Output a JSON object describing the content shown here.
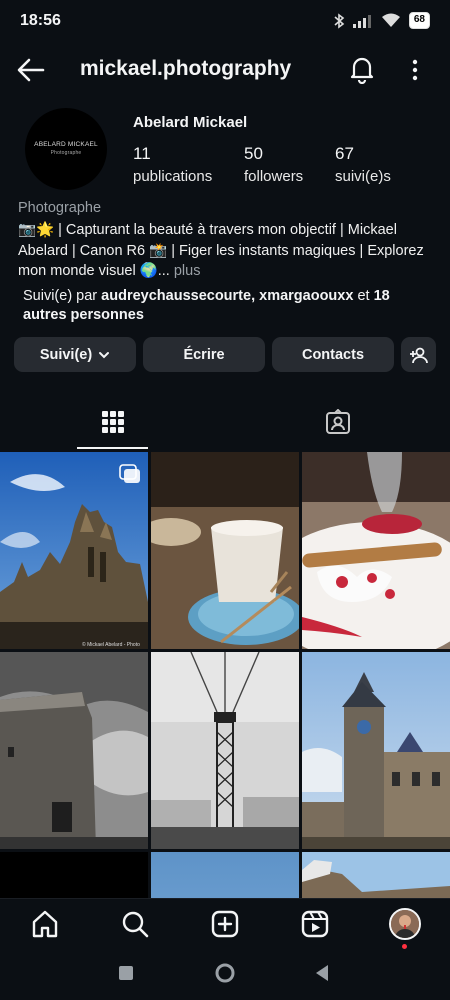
{
  "status_bar": {
    "time": "18:56",
    "battery": "68"
  },
  "header": {
    "username": "mickael.photography"
  },
  "profile": {
    "avatar_logo_line1": "ABELARD MICKAEL",
    "avatar_logo_line2": "Photographe",
    "full_name": "Abelard Mickael",
    "stats": [
      {
        "value": "11",
        "label": "publications"
      },
      {
        "value": "50",
        "label": "followers"
      },
      {
        "value": "67",
        "label": "suivi(e)s"
      }
    ],
    "category": "Photographe",
    "bio": "📷🌟 | Capturant la beauté à travers mon objectif | Mickael Abelard | Canon R6 📸 | Figer les instants magiques | Explorez mon monde visuel 🌍...",
    "bio_more": " plus",
    "followed_by_prefix": "Suivi(e) par ",
    "followed_by_names": "audreychaussecourte, xmargaoouxx",
    "followed_by_middle": " et ",
    "followed_by_rest": "18 autres personnes"
  },
  "actions": {
    "following_label": "Suivi(e)",
    "message_label": "Écrire",
    "contacts_label": "Contacts"
  },
  "tabs": [
    {
      "icon": "grid-icon",
      "selected": true
    },
    {
      "icon": "tagged-icon",
      "selected": false
    }
  ],
  "grid_posts": [
    {
      "subject": "gothic cathedral blue sky",
      "watermark": "© Mickael Abelard - Photo",
      "multi": true
    },
    {
      "subject": "latte in glass cup on blue saucer"
    },
    {
      "subject": "dessert with cream and raspberry sauce"
    },
    {
      "subject": "round stone tower black and white"
    },
    {
      "subject": "transporter bridge black and white"
    },
    {
      "subject": "astronomical clock tower Prague"
    },
    {
      "subject": "dark tile"
    },
    {
      "subject": "blue sky"
    },
    {
      "subject": "hilltop sky"
    }
  ],
  "bottom_nav": [
    "home-icon",
    "search-icon",
    "create-icon",
    "reels-icon",
    "profile-avatar"
  ],
  "colors": {
    "background": "#0b0f14",
    "button": "#272b31",
    "muted": "#9aa0a6",
    "notification_dot": "#ff3040"
  }
}
